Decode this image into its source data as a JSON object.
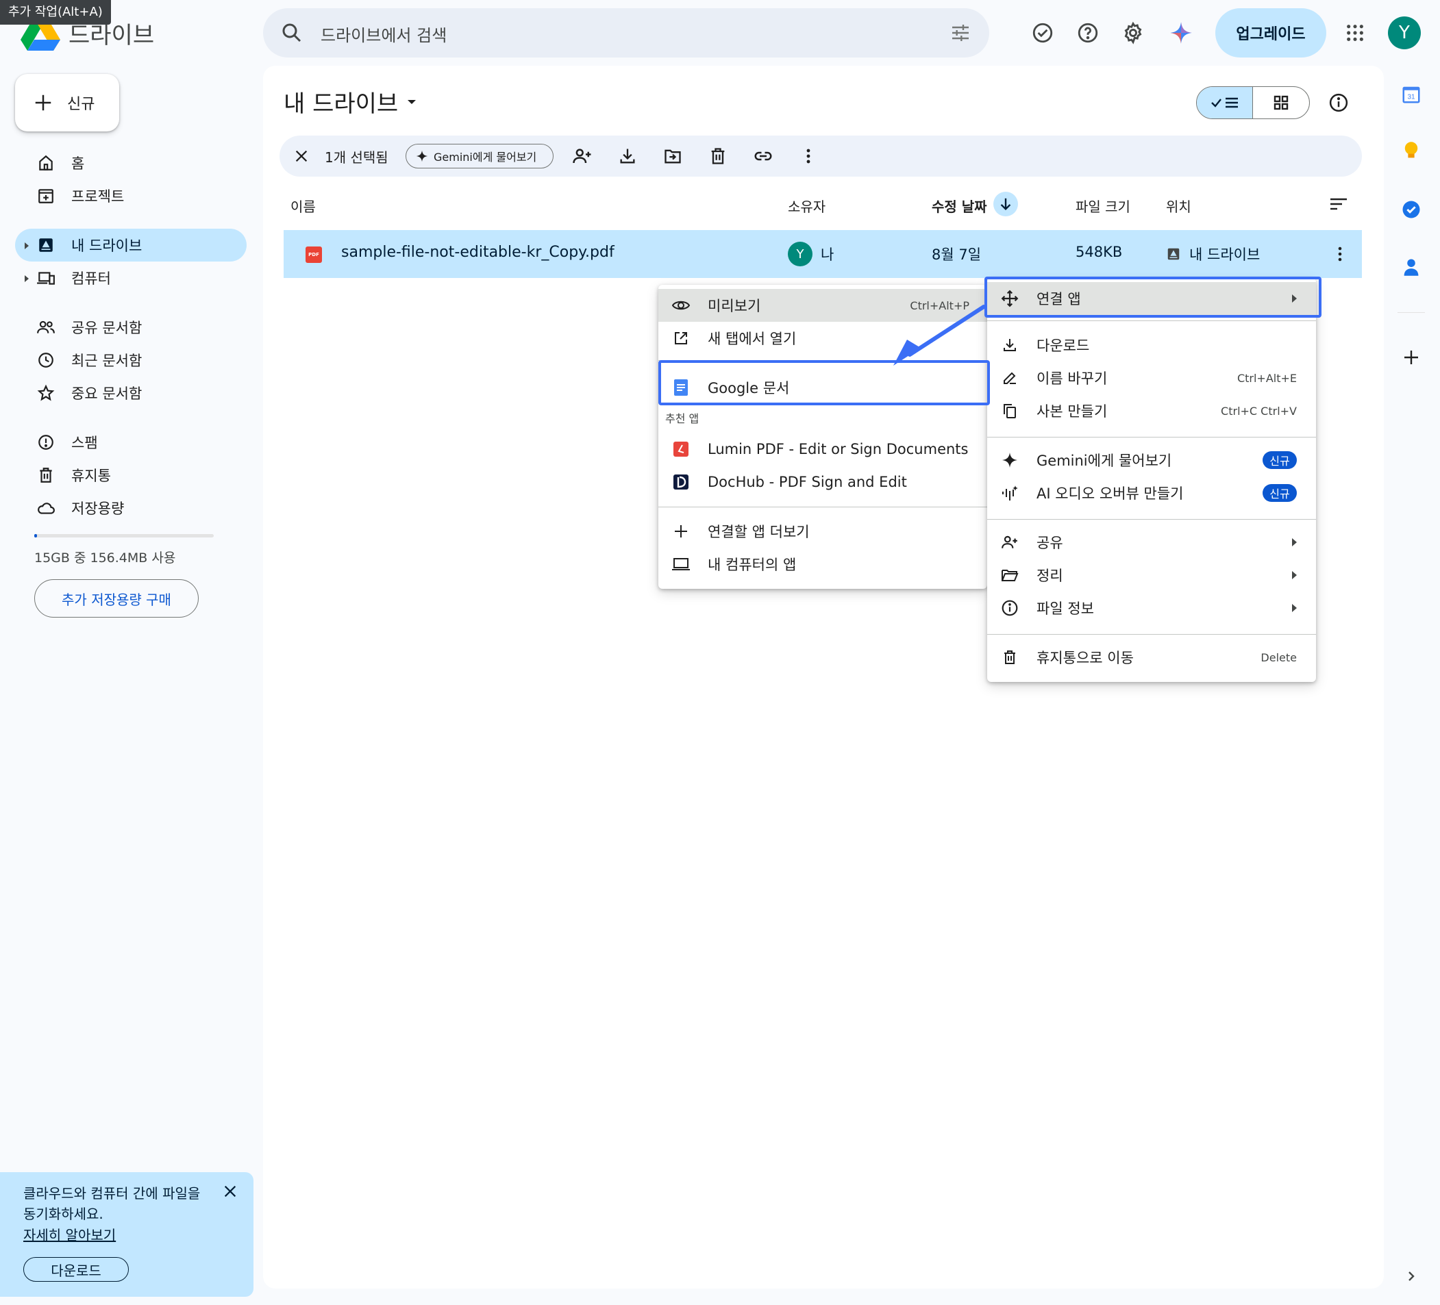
{
  "tooltip": "추가 작업(Alt+A)",
  "header": {
    "brand": "드라이브",
    "search_placeholder": "드라이브에서 검색",
    "upgrade_label": "업그레이드",
    "avatar_letter": "Y"
  },
  "sidebar": {
    "new_label": "신규",
    "items": [
      {
        "label": "홈",
        "icon": "home-icon"
      },
      {
        "label": "프로젝트",
        "icon": "projects-icon"
      },
      {
        "label": "내 드라이브",
        "icon": "my-drive-icon"
      },
      {
        "label": "컴퓨터",
        "icon": "computers-icon"
      },
      {
        "label": "공유 문서함",
        "icon": "shared-icon"
      },
      {
        "label": "최근 문서함",
        "icon": "clock-icon"
      },
      {
        "label": "중요 문서함",
        "icon": "star-icon"
      },
      {
        "label": "스팸",
        "icon": "spam-icon"
      },
      {
        "label": "휴지통",
        "icon": "trash-icon"
      },
      {
        "label": "저장용량",
        "icon": "cloud-icon"
      }
    ],
    "storage_text": "15GB 중 156.4MB 사용",
    "storage_used_fraction": 0.01,
    "buy_storage_label": "추가 저장용량 구매"
  },
  "promo": {
    "text": "클라우드와 컴퓨터 간에 파일을 동기화하세요.",
    "link": "자세히 알아보기",
    "button": "다운로드"
  },
  "main": {
    "title": "내 드라이브",
    "selection": {
      "count": "1개 선택됨",
      "gemini": "Gemini에게 물어보기"
    },
    "columns": {
      "name": "이름",
      "owner": "소유자",
      "modified": "수정 날짜",
      "size": "파일 크기",
      "location": "위치"
    },
    "file": {
      "type_badge": "PDF",
      "name": "sample-file-not-editable-kr_Copy.pdf",
      "owner_letter": "Y",
      "owner": "나",
      "modified": "8월 7일",
      "size": "548KB",
      "location": "내 드라이브"
    }
  },
  "context_menu": {
    "open_with": "연결 앱",
    "download": "다운로드",
    "rename": "이름 바꾸기",
    "rename_shortcut": "Ctrl+Alt+E",
    "copy": "사본 만들기",
    "copy_shortcut": "Ctrl+C Ctrl+V",
    "gemini": "Gemini에게 물어보기",
    "audio": "AI 오디오 오버뷰 만들기",
    "new_badge": "신규",
    "share": "공유",
    "organize": "정리",
    "file_info": "파일 정보",
    "trash": "휴지통으로 이동",
    "trash_shortcut": "Delete"
  },
  "submenu": {
    "preview": "미리보기",
    "preview_shortcut": "Ctrl+Alt+P",
    "new_tab": "새 탭에서 열기",
    "google_docs": "Google 문서",
    "suggested_header": "추천 앱",
    "lumin": "Lumin PDF - Edit or Sign Documents",
    "dochub": "DocHub - PDF Sign and Edit",
    "more_apps": "연결할 앱 더보기",
    "computer_apps": "내 컴퓨터의 앱"
  },
  "colors": {
    "accent": "#0b57d0",
    "selected_bg": "#c2e7ff",
    "highlight_box": "#3b6ef5",
    "avatar": "#00897b"
  }
}
